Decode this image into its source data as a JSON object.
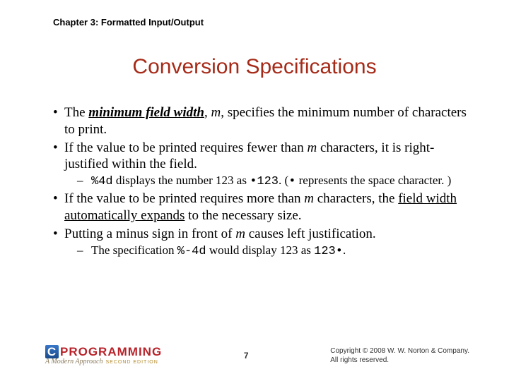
{
  "chapter": "Chapter 3: Formatted Input/Output",
  "title": "Conversion Specifications",
  "bullets": {
    "b1": {
      "pre": "The ",
      "term": "minimum field width",
      "mid": ", ",
      "m": "m",
      "post": ", specifies the minimum number of characters to print."
    },
    "b2": {
      "pre": "If the value to be printed requires fewer than ",
      "m": "m",
      "post": " characters, it is right-justified within the field."
    },
    "b2s": {
      "code1": "%4d",
      "mid1": " displays the number 123 as ",
      "code2": "•123",
      "mid2": ". (",
      "dot": "•",
      "post": " represents the space character. )"
    },
    "b3": {
      "pre": "If the value to be printed requires more than ",
      "m": "m",
      "mid": " characters, the ",
      "u": "field width automatically expands",
      "post": " to the necessary size."
    },
    "b4": {
      "pre": "Putting a minus sign in front of ",
      "m": "m",
      "post": " causes left justification."
    },
    "b4s": {
      "pre": "The specification ",
      "code1": "%-4d",
      "mid": " would display 123 as ",
      "code2": "123•",
      "post": "."
    }
  },
  "footer": {
    "logo_main": "PROGRAMMING",
    "logo_c": "C",
    "logo_sub": "A Modern Approach",
    "logo_ed": "SECOND EDITION",
    "page": "7",
    "copy1": "Copyright © 2008 W. W. Norton & Company.",
    "copy2": "All rights reserved."
  }
}
